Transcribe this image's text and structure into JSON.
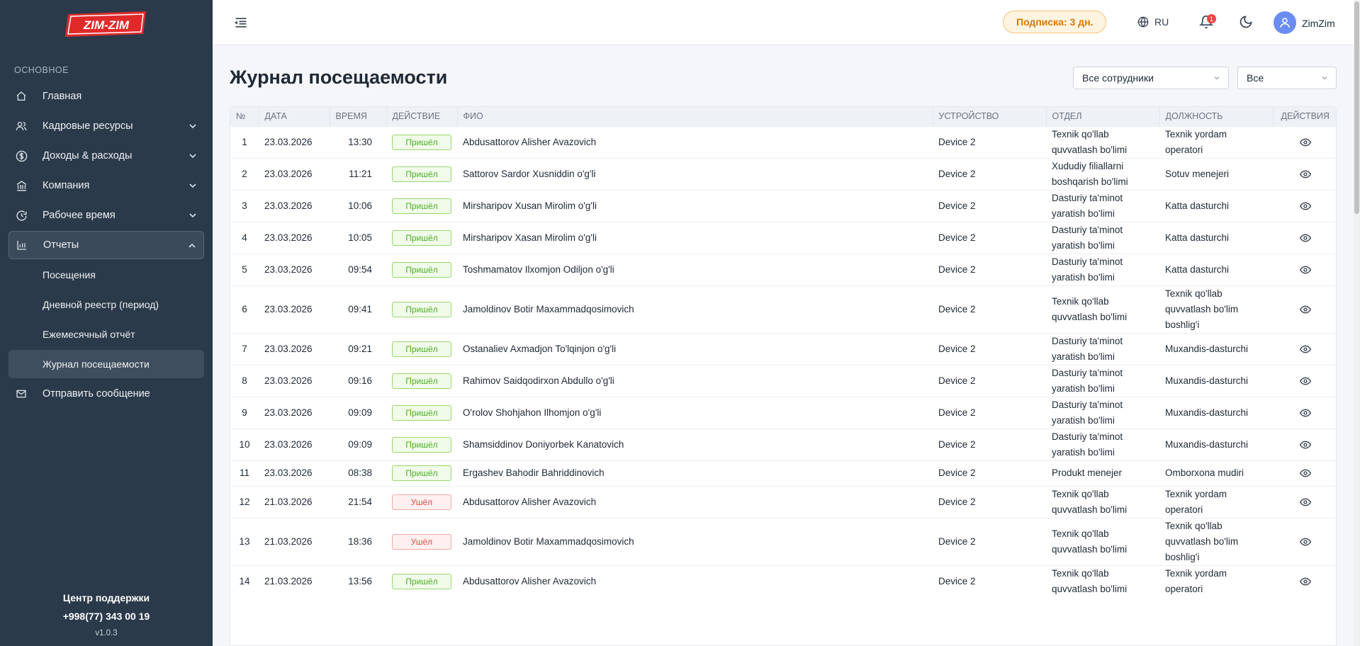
{
  "brand": {
    "logo_text": "ZIM-ZIM"
  },
  "sidebar": {
    "section_title": "ОСНОВНОЕ",
    "items": [
      {
        "label": "Главная",
        "icon": "home-icon"
      },
      {
        "label": "Кадровые ресурсы",
        "icon": "users-icon"
      },
      {
        "label": "Доходы & расходы",
        "icon": "dollar-icon"
      },
      {
        "label": "Компания",
        "icon": "bank-icon"
      },
      {
        "label": "Рабочее время",
        "icon": "clock-icon"
      },
      {
        "label": "Отчеты",
        "icon": "bar-chart-icon"
      }
    ],
    "reports_sub": [
      {
        "label": "Посещения"
      },
      {
        "label": "Дневной реестр (период)"
      },
      {
        "label": "Ежемесячный отчёт"
      },
      {
        "label": "Журнал посещаемости"
      }
    ],
    "send_message": "Отправить сообщение",
    "support_title": "Центр поддержки",
    "support_phone": "+998(77) 343 00 19",
    "version": "v1.0.3"
  },
  "header": {
    "subscription": "Подписка: 3 дн.",
    "language": "RU",
    "notifications_count": "1",
    "username": "ZimZim"
  },
  "page": {
    "title": "Журнал посещаемости",
    "filter_employees": "Все сотрудники",
    "filter_type": "Все"
  },
  "table": {
    "headers": [
      "№",
      "ДАТА",
      "ВРЕМЯ",
      "ДЕЙСТВИЕ",
      "ФИО",
      "УСТРОЙСТВО",
      "ОТДЕЛ",
      "ДОЛЖНОСТЬ",
      "ДЕЙСТВИЯ"
    ],
    "rows": [
      {
        "n": "1",
        "date": "23.03.2026",
        "time": "13:30",
        "action": "Пришёл",
        "type": "in",
        "name": "Abdusattorov Alisher Avazovich",
        "device": "Device 2",
        "dept": "Texnik qo'llab quvvatlash bo'limi",
        "pos": "Texnik yordam operatori"
      },
      {
        "n": "2",
        "date": "23.03.2026",
        "time": "11:21",
        "action": "Пришёл",
        "type": "in",
        "name": "Sattorov Sardor Xusniddin o'g'li",
        "device": "Device 2",
        "dept": "Xududiy filiallarni boshqarish bo'limi",
        "pos": "Sotuv menejeri"
      },
      {
        "n": "3",
        "date": "23.03.2026",
        "time": "10:06",
        "action": "Пришёл",
        "type": "in",
        "name": "Mirsharipov Xusan Mirolim o'g'li",
        "device": "Device 2",
        "dept": "Dasturiy ta'minot yaratish bo'limi",
        "pos": "Katta dasturchi"
      },
      {
        "n": "4",
        "date": "23.03.2026",
        "time": "10:05",
        "action": "Пришёл",
        "type": "in",
        "name": "Mirsharipov Xasan Mirolim o'g'li",
        "device": "Device 2",
        "dept": "Dasturiy ta'minot yaratish bo'limi",
        "pos": "Katta dasturchi"
      },
      {
        "n": "5",
        "date": "23.03.2026",
        "time": "09:54",
        "action": "Пришёл",
        "type": "in",
        "name": "Toshmamatov Ilxomjon Odiljon o'g'li",
        "device": "Device 2",
        "dept": "Dasturiy ta'minot yaratish bo'limi",
        "pos": "Katta dasturchi"
      },
      {
        "n": "6",
        "date": "23.03.2026",
        "time": "09:41",
        "action": "Пришёл",
        "type": "in",
        "name": "Jamoldinov Botir Maxammadqosimovich",
        "device": "Device 2",
        "dept": "Texnik qo'llab quvvatlash bo'limi",
        "pos": "Texnik qo'llab quvvatlash bo'lim boshlig'i"
      },
      {
        "n": "7",
        "date": "23.03.2026",
        "time": "09:21",
        "action": "Пришёл",
        "type": "in",
        "name": "Ostanaliev Axmadjon To'lqinjon o'g'li",
        "device": "Device 2",
        "dept": "Dasturiy ta'minot yaratish bo'limi",
        "pos": "Muxandis-dasturchi"
      },
      {
        "n": "8",
        "date": "23.03.2026",
        "time": "09:16",
        "action": "Пришёл",
        "type": "in",
        "name": "Rahimov Saidqodirxon Abdullo o'g'li",
        "device": "Device 2",
        "dept": "Dasturiy ta'minot yaratish bo'limi",
        "pos": "Muxandis-dasturchi"
      },
      {
        "n": "9",
        "date": "23.03.2026",
        "time": "09:09",
        "action": "Пришёл",
        "type": "in",
        "name": "O'rolov Shohjahon Ilhomjon o'g'li",
        "device": "Device 2",
        "dept": "Dasturiy ta'minot yaratish bo'limi",
        "pos": "Muxandis-dasturchi"
      },
      {
        "n": "10",
        "date": "23.03.2026",
        "time": "09:09",
        "action": "Пришёл",
        "type": "in",
        "name": "Shamsiddinov Doniyorbek Kanatovich",
        "device": "Device 2",
        "dept": "Dasturiy ta'minot yaratish bo'limi",
        "pos": "Muxandis-dasturchi"
      },
      {
        "n": "11",
        "date": "23.03.2026",
        "time": "08:38",
        "action": "Пришёл",
        "type": "in",
        "name": "Ergashev Bahodir Bahriddinovich",
        "device": "Device 2",
        "dept": "Produkt menejer",
        "pos": "Omborxona mudiri"
      },
      {
        "n": "12",
        "date": "21.03.2026",
        "time": "21:54",
        "action": "Ушёл",
        "type": "out",
        "name": "Abdusattorov Alisher Avazovich",
        "device": "Device 2",
        "dept": "Texnik qo'llab quvvatlash bo'limi",
        "pos": "Texnik yordam operatori"
      },
      {
        "n": "13",
        "date": "21.03.2026",
        "time": "18:36",
        "action": "Ушёл",
        "type": "out",
        "name": "Jamoldinov Botir Maxammadqosimovich",
        "device": "Device 2",
        "dept": "Texnik qo'llab quvvatlash bo'limi",
        "pos": "Texnik qo'llab quvvatlash bo'lim boshlig'i"
      },
      {
        "n": "14",
        "date": "21.03.2026",
        "time": "13:56",
        "action": "Пришёл",
        "type": "in",
        "name": "Abdusattorov Alisher Avazovich",
        "device": "Device 2",
        "dept": "Texnik qo'llab quvvatlash bo'limi",
        "pos": "Texnik yordam operatori"
      }
    ]
  },
  "colors": {
    "sidebar_bg": "#2b3a4a",
    "accent_in": "#4caf26",
    "accent_out": "#e24848",
    "subscription": "#d97706"
  }
}
